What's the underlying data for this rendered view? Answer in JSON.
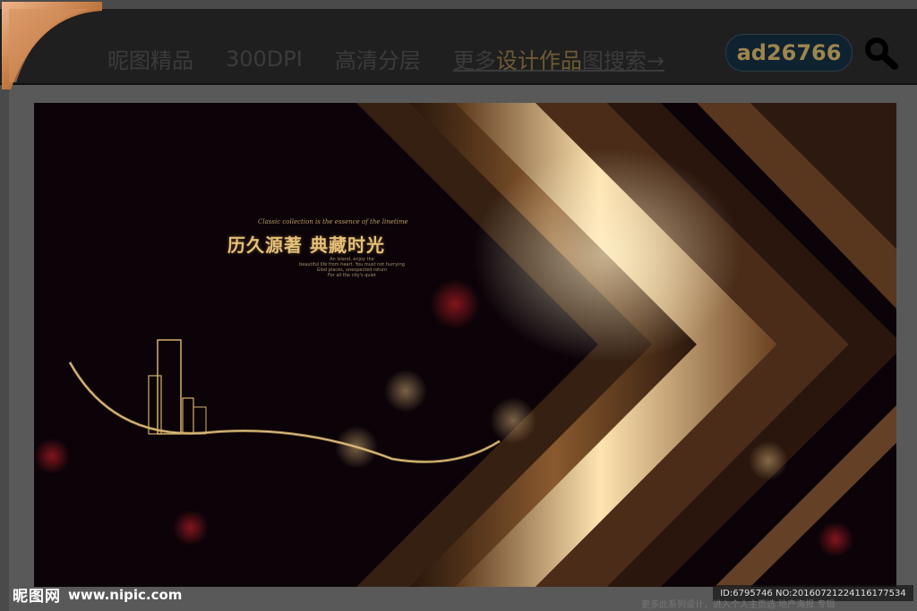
{
  "nav": {
    "items": [
      "昵图精品",
      "300DPI",
      "高清分层"
    ],
    "more_prefix": "更多",
    "more_highlight": "设计作品",
    "more_suffix": "图搜索→"
  },
  "badge": {
    "id": "ad26766"
  },
  "poster": {
    "tagline_en": "Classic collection is the essence of the linetime",
    "title": "历久源著 典藏时光",
    "subtext": [
      "An island, enjoy the",
      "beautiful life from heart. You must not hurrying",
      "Glod places, unexpected return",
      "For all the city's quiet"
    ]
  },
  "watermark": {
    "site_name": "昵图网",
    "url": "www.nipic.com",
    "id_text": "ID:6795746 NO:20160721224116177534",
    "footer_note": "更多此系列设计，进入个人主页选 地产海报 专辑"
  },
  "colors": {
    "gold": "#e6c07a",
    "badge_bg": "#0e2230",
    "badge_text": "#9e854e"
  },
  "icons": [
    "corner-ornament-icon",
    "search-icon"
  ]
}
